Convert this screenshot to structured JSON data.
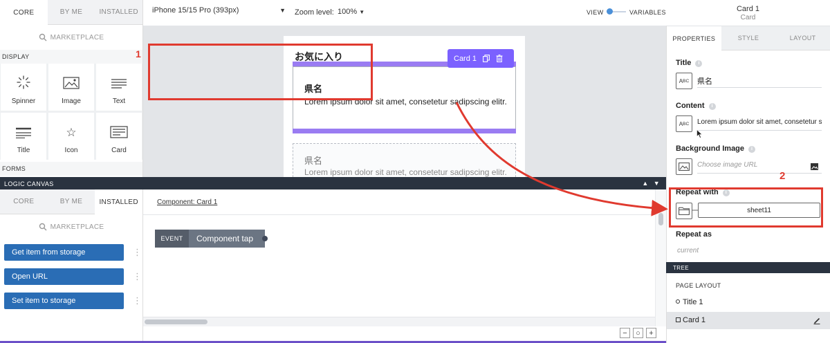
{
  "colors": {
    "accent": "#7b61ff",
    "highlight": "#e03a2f",
    "button_blue": "#2a6db5",
    "dark_bar": "#2a3340"
  },
  "component_panel": {
    "tabs": [
      "CORE",
      "BY ME",
      "INSTALLED"
    ],
    "marketplace": "MARKETPLACE",
    "display_section": "DISPLAY",
    "items": [
      {
        "label": "Spinner",
        "icon": "spinner-icon"
      },
      {
        "label": "Image",
        "icon": "image-icon"
      },
      {
        "label": "Text",
        "icon": "text-icon"
      },
      {
        "label": "Title",
        "icon": "title-icon"
      },
      {
        "label": "Icon",
        "icon": "star-icon"
      },
      {
        "label": "Card",
        "icon": "card-icon"
      }
    ],
    "forms_section": "FORMS"
  },
  "toolbar": {
    "device": "iPhone 15/15 Pro (393px)",
    "zoom_label": "Zoom level:",
    "zoom_value": "100%",
    "view_label": "VIEW",
    "variables_label": "VARIABLES"
  },
  "canvas": {
    "heading": "お気に入り",
    "selected_component": "Card 1",
    "card_title": "県名",
    "card_content": "Lorem ipsum dolor sit amet, consetetur sadipscing elitr.",
    "annotation_1": "1"
  },
  "logic": {
    "bar_label": "LOGIC CANVAS",
    "tabs": [
      "CORE",
      "BY ME",
      "INSTALLED"
    ],
    "marketplace": "MARKETPLACE",
    "buttons": [
      "Get item from storage",
      "Open URL",
      "Set item to storage"
    ],
    "component_link": "Component: Card 1",
    "event_tag": "EVENT",
    "event_name": "Component tap"
  },
  "right": {
    "header_title": "Card 1",
    "header_sub": "Card",
    "tabs": [
      "PROPERTIES",
      "STYLE",
      "LAYOUT"
    ],
    "title_label": "Title",
    "title_value": "県名",
    "content_label": "Content",
    "content_value": "Lorem ipsum dolor sit amet, consetetur sadipscing elitr.",
    "bg_label": "Background Image",
    "bg_placeholder": "Choose image URL",
    "repeat_with_label": "Repeat with",
    "repeat_with_value": "sheet11",
    "repeat_as_label": "Repeat as",
    "repeat_as_value": "current",
    "annotation_2": "2"
  },
  "tree": {
    "bar_label": "TREE",
    "page_layout": "PAGE LAYOUT",
    "items": [
      "Title 1",
      "Card 1"
    ]
  }
}
